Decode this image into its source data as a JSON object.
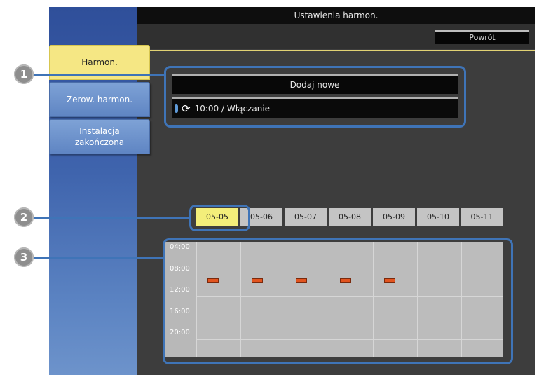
{
  "window": {
    "title": "Ustawienia harmon.",
    "back_label": "Powrót"
  },
  "sidebar": {
    "tabs": [
      {
        "label": "Harmon.",
        "active": true
      },
      {
        "label": "Zerow. harmon.",
        "active": false
      },
      {
        "label": "Instalacja\nzakończona",
        "active": false
      }
    ]
  },
  "schedule": {
    "add_new_label": "Dodaj nowe",
    "entry_text": "10:00 / Włączanie"
  },
  "calendar": {
    "dates": [
      "05-05",
      "05-06",
      "05-07",
      "05-08",
      "05-09",
      "05-10",
      "05-11"
    ],
    "selected_date": "05-05",
    "time_labels": [
      "04:00",
      "08:00",
      "12:00",
      "16:00",
      "20:00"
    ],
    "events": [
      "05-05",
      "05-06",
      "05-07",
      "05-08",
      "05-09"
    ]
  },
  "callouts": [
    "1",
    "2",
    "3"
  ],
  "colors": {
    "callout_blue": "#3f74b7",
    "active_tab": "#f5e784",
    "event_orange": "#e2541f"
  },
  "icons": {
    "battery": "battery-icon",
    "repeat": "repeat-icon"
  }
}
